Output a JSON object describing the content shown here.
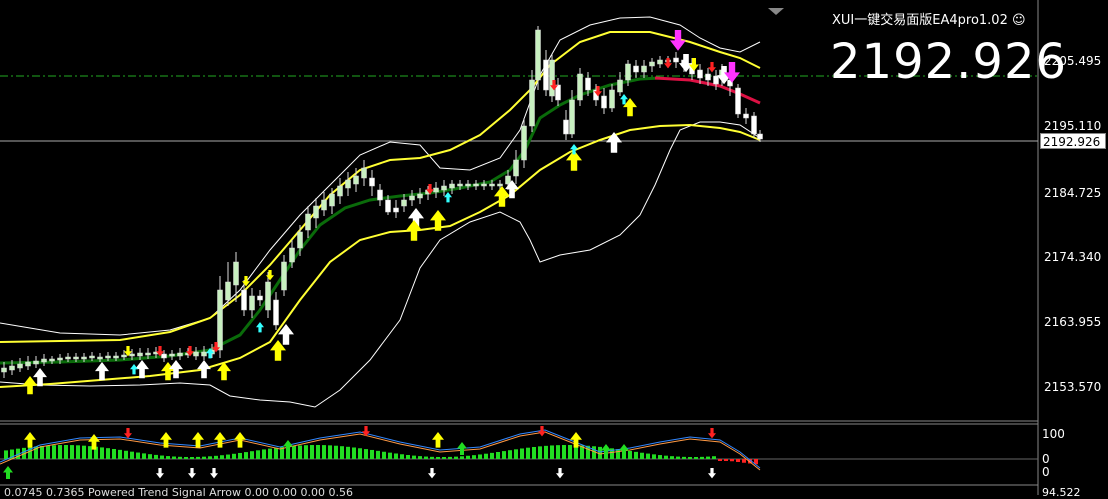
{
  "window": {
    "ea_title": "XUI一键交易面版EA4pro1.02",
    "ea_status_icon": "smiley-icon",
    "big_price": "2192.926"
  },
  "price_axis": {
    "labels": [
      "2205.495",
      "2195.110",
      "2184.725",
      "2174.340",
      "2163.955",
      "2153.570"
    ],
    "current_price": "2192.926"
  },
  "oscillator_axis": {
    "labels": [
      "100",
      "0",
      "0"
    ]
  },
  "bottom_strip": {
    "status_text": "0.0745 0.7365 Powered Trend Signal Arrow 0.00 0.00 0.00 0.56",
    "axis_value": "94.522"
  },
  "colors": {
    "background": "#000000",
    "candle_up": "#c8f0c0",
    "candle_down": "#ffffff",
    "bollinger": "#ffffff",
    "envelope": "#ffff33",
    "ma_line": "#0a6b0a",
    "ma_bear": "#dd1144",
    "arrow_yellow": "#ffff00",
    "arrow_white": "#ffffff",
    "arrow_cyan": "#33ffff",
    "arrow_red": "#ff2222",
    "arrow_magenta": "#ff33ff",
    "arrow_green": "#22dd22",
    "dash_level": "#22aa22"
  }
}
